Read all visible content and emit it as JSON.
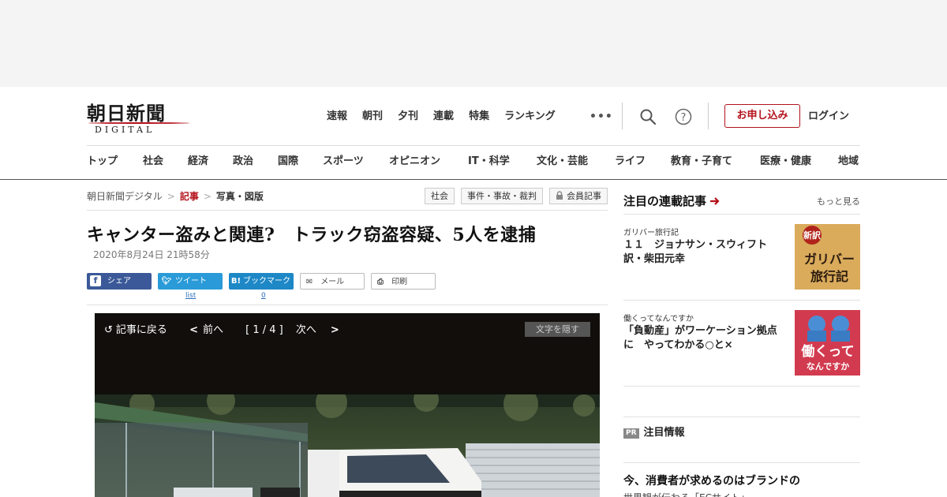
{
  "header": {
    "logo_main": "朝日新聞",
    "logo_sub": "DIGITAL",
    "top_nav": [
      "速報",
      "朝刊",
      "夕刊",
      "連載",
      "特集",
      "ランキング"
    ],
    "more_label": "•••",
    "apply_label": "お申し込み",
    "login_label": "ログイン"
  },
  "main_nav": [
    "トップ",
    "社会",
    "経済",
    "政治",
    "国際",
    "スポーツ",
    "オピニオン",
    "IT・科学",
    "文化・芸能",
    "ライフ",
    "教育・子育て",
    "医療・健康",
    "地域"
  ],
  "breadcrumb": [
    "朝日新聞デジタル",
    "記事",
    "写真・図版"
  ],
  "breadcrumb_sep": ">",
  "tags": [
    "社会",
    "事件・事故・裁判",
    "会員記事"
  ],
  "article": {
    "headline": "キャンター盗みと関連?　トラック窃盗容疑、5人を逮捕",
    "date": "2020年8月24日 21時58分"
  },
  "share": {
    "facebook": "シェア",
    "twitter": "ツイート",
    "hatena": "ブックマーク",
    "mail": "メール",
    "print": "印刷",
    "twitter_count": "list",
    "hatena_count": "0"
  },
  "viewer": {
    "back": "記事に戻る",
    "prev": "前へ",
    "page": "[ 1 / 4 ]",
    "next": "次へ",
    "hide_text": "文字を隠す"
  },
  "sidebar": {
    "title": "注目の連載記事",
    "more": "もっと見る",
    "serials": [
      {
        "label": "ガリバー旅行記",
        "title": "１１　ジョナサン・スウィフト　訳・柴田元幸",
        "thumb_badge": "新訳",
        "thumb_text": "ガリバー旅行記"
      },
      {
        "label": "働くってなんですか",
        "title": "「負動産」がワーケーション拠点に　やってわかる○と×",
        "thumb_text": "働くって",
        "thumb_text2": "なんですか"
      }
    ],
    "pr_badge": "PR",
    "pr_title": "注目情報",
    "pr_article": "今、消費者が求めるのはブランドの",
    "pr_sub": "世界観が伝わる「ECサイト」"
  },
  "colors": {
    "brand_red": "#b5121b",
    "facebook": "#3b5998",
    "twitter": "#2a9bd8",
    "hatena": "#1e88c7"
  }
}
